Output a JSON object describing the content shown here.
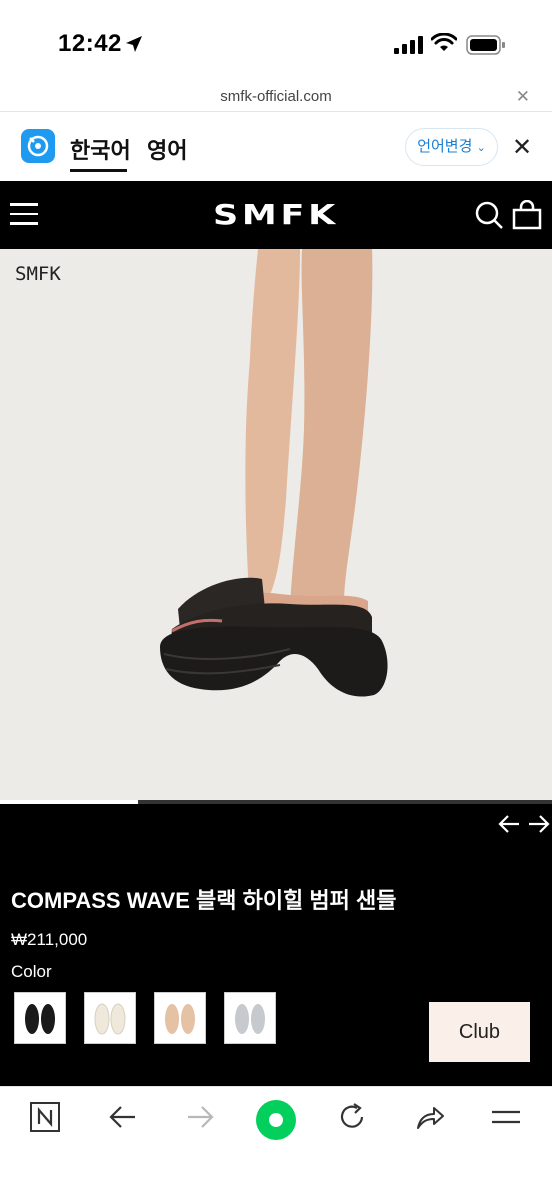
{
  "status": {
    "time": "12:42"
  },
  "browser": {
    "url": "smfk-official.com"
  },
  "translate": {
    "source_tab": "한국어",
    "target_tab": "영어",
    "change_button": "언어변경"
  },
  "site": {
    "logo": "SMFK"
  },
  "hero": {
    "brand_mark": "SMFK",
    "slide_progress": 0.25
  },
  "product": {
    "title": "COMPASS WAVE 블랙 하이힐 범퍼 샌들",
    "price": "₩211,000",
    "color_label": "Color",
    "swatches": [
      {
        "name": "black",
        "color": "#1a1a1a"
      },
      {
        "name": "ivory",
        "color": "#f1ece1"
      },
      {
        "name": "nude",
        "color": "#e6c4a6"
      },
      {
        "name": "silver",
        "color": "#c7cbd0"
      }
    ],
    "club_button": "Club"
  },
  "colors": {
    "accent_green": "#03cf5d",
    "papago_blue": "#1e9bf0",
    "link_blue": "#1d7fd1"
  }
}
